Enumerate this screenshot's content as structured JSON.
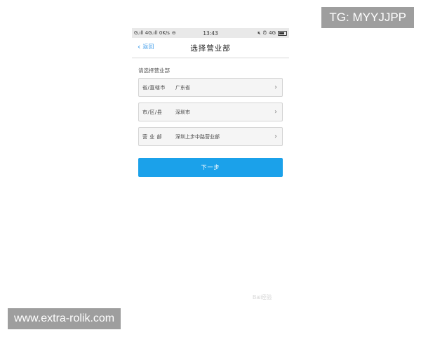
{
  "overlay": {
    "tag": "TG: MYYJJPP",
    "site": "www.extra-rolik.com",
    "watermark": "Bai经验"
  },
  "statusbar": {
    "left": "G.ıll 4G.ıll 0K/s",
    "time": "13:43",
    "network": "4G"
  },
  "navbar": {
    "back_label": "返回",
    "title": "选择营业部"
  },
  "section_label": "请选择营业部",
  "rows": [
    {
      "key": "省/直辖市",
      "value": "广东省"
    },
    {
      "key": "市/区/县",
      "value": "深圳市"
    },
    {
      "key": "营 业 部",
      "value": "深圳上步中路营业部"
    }
  ],
  "next_button": "下一步"
}
